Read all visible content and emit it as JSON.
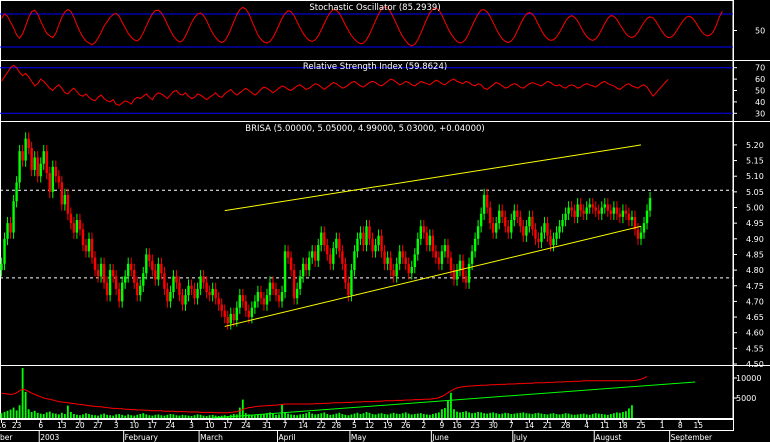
{
  "colors": {
    "background": "#000000",
    "frame": "#ffffff",
    "up_candle": "#00ff00",
    "down_candle": "#ff0000",
    "oscillator_line": "#ff0000",
    "band_line": "#0000ff",
    "channel_line": "#ffff00",
    "volume_bar": "#00ff00",
    "volume_average": "#ff0000",
    "volume_trend": "#00ff00"
  },
  "stochastic": {
    "title": "Stochastic Oscillator (85.2939)",
    "current": 85.2939,
    "ylim": [
      0,
      100
    ],
    "bands": [
      80,
      20
    ],
    "ticks": [
      "50"
    ],
    "values": [
      72,
      80,
      76,
      65,
      55,
      42,
      36,
      44,
      58,
      74,
      84,
      87,
      80,
      67,
      55,
      45,
      40,
      37,
      45,
      60,
      74,
      84,
      88,
      85,
      74,
      60,
      48,
      38,
      31,
      27,
      24,
      28,
      36,
      46,
      58,
      66,
      74,
      79,
      81,
      76,
      65,
      55,
      45,
      38,
      33,
      31,
      36,
      46,
      58,
      70,
      80,
      86,
      87,
      82,
      73,
      61,
      50,
      40,
      33,
      29,
      31,
      40,
      52,
      64,
      74,
      80,
      82,
      77,
      68,
      56,
      45,
      37,
      31,
      28,
      31,
      40,
      52,
      66,
      79,
      88,
      92,
      89,
      80,
      67,
      54,
      42,
      34,
      29,
      27,
      30,
      37,
      48,
      60,
      72,
      81,
      86,
      84,
      77,
      66,
      55,
      45,
      37,
      32,
      30,
      33,
      40,
      51,
      63,
      74,
      83,
      88,
      87,
      81,
      71,
      60,
      50,
      41,
      34,
      29,
      26,
      27,
      33,
      43,
      55,
      68,
      80,
      89,
      93,
      91,
      84,
      73,
      61,
      49,
      39,
      31,
      25,
      22,
      25,
      33,
      45,
      58,
      71,
      82,
      89,
      91,
      87,
      78,
      66,
      54,
      44,
      36,
      30,
      27,
      29,
      35,
      46,
      58,
      70,
      80,
      87,
      88,
      84,
      75,
      64,
      53,
      43,
      35,
      30,
      28,
      31,
      38,
      49,
      61,
      72,
      80,
      83,
      80,
      72,
      61,
      50,
      41,
      35,
      32,
      33,
      38,
      47,
      57,
      67,
      74,
      77,
      74,
      67,
      57,
      47,
      39,
      34,
      32,
      35,
      42,
      52,
      63,
      72,
      77,
      76,
      70,
      61,
      52,
      44,
      39,
      37,
      40,
      47,
      56,
      65,
      72,
      75,
      73,
      66,
      57,
      48,
      41,
      37,
      38,
      43,
      51,
      60,
      68,
      74,
      76,
      73,
      66,
      57,
      49,
      43,
      40,
      42,
      48,
      60,
      75,
      85
    ]
  },
  "rsi": {
    "title": "Relative Strength Index (59.8624)",
    "current": 59.8624,
    "ylim": [
      25,
      75
    ],
    "bands": [
      70,
      30
    ],
    "ticks": [
      "70",
      "60",
      "50",
      "40",
      "30"
    ],
    "values": [
      58,
      62,
      66,
      70,
      72,
      70,
      66,
      63,
      65,
      62,
      58,
      54,
      56,
      60,
      58,
      55,
      52,
      50,
      53,
      55,
      52,
      48,
      47,
      50,
      52,
      49,
      46,
      45,
      47,
      44,
      42,
      41,
      44,
      46,
      43,
      41,
      40,
      42,
      38,
      37,
      39,
      41,
      40,
      38,
      42,
      44,
      43,
      45,
      47,
      44,
      42,
      46,
      48,
      47,
      45,
      43,
      46,
      49,
      50,
      47,
      46,
      48,
      45,
      43,
      44,
      47,
      46,
      44,
      42,
      44,
      46,
      48,
      45,
      44,
      47,
      49,
      51,
      48,
      46,
      48,
      50,
      52,
      50,
      48,
      46,
      48,
      51,
      53,
      52,
      50,
      48,
      50,
      52,
      54,
      53,
      51,
      50,
      52,
      54,
      55,
      53,
      51,
      52,
      54,
      56,
      55,
      53,
      51,
      53,
      55,
      57,
      56,
      54,
      52,
      53,
      55,
      57,
      58,
      56,
      54,
      53,
      55,
      57,
      58,
      57,
      55,
      54,
      56,
      58,
      60,
      59,
      57,
      55,
      56,
      58,
      57,
      55,
      54,
      56,
      58,
      57,
      56,
      55,
      57,
      59,
      58,
      56,
      55,
      57,
      59,
      60,
      58,
      57,
      56,
      58,
      57,
      55,
      54,
      56,
      55,
      52,
      51,
      53,
      55,
      57,
      56,
      54,
      52,
      53,
      55,
      56,
      55,
      53,
      52,
      54,
      56,
      57,
      56,
      55,
      54,
      56,
      58,
      57,
      55,
      54,
      55,
      53,
      52,
      54,
      55,
      54,
      52,
      53,
      55,
      56,
      55,
      54,
      53,
      55,
      57,
      58,
      56,
      55,
      54,
      52,
      51,
      53,
      55,
      56,
      54,
      53,
      52,
      54,
      55,
      53,
      49,
      45,
      48,
      51,
      54,
      57,
      59.8624
    ]
  },
  "price": {
    "title": "BRISA (5.00000, 5.05000, 4.99000, 5.03000, +0.04000)",
    "ylim": [
      4.5,
      5.27
    ],
    "ticks": [
      "5.20",
      "5.15",
      "5.10",
      "5.05",
      "5.00",
      "4.95",
      "4.90",
      "4.85",
      "4.80",
      "4.75",
      "4.70",
      "4.65",
      "4.60",
      "4.55",
      "4.50"
    ],
    "reference_levels": [
      5.055,
      4.775
    ],
    "closes": [
      4.82,
      4.9,
      4.95,
      4.92,
      5.02,
      5.08,
      5.18,
      5.15,
      5.22,
      5.19,
      5.12,
      5.16,
      5.1,
      5.14,
      5.18,
      5.11,
      5.05,
      5.13,
      5.1,
      5.08,
      5.01,
      5.04,
      4.98,
      4.95,
      4.92,
      4.96,
      4.93,
      4.88,
      4.86,
      4.9,
      4.84,
      4.8,
      4.78,
      4.82,
      4.76,
      4.72,
      4.8,
      4.78,
      4.74,
      4.7,
      4.76,
      4.78,
      4.82,
      4.8,
      4.76,
      4.72,
      4.75,
      4.79,
      4.85,
      4.83,
      4.8,
      4.77,
      4.82,
      4.79,
      4.74,
      4.7,
      4.73,
      4.78,
      4.76,
      4.72,
      4.69,
      4.72,
      4.75,
      4.74,
      4.71,
      4.74,
      4.78,
      4.76,
      4.73,
      4.72,
      4.74,
      4.71,
      4.69,
      4.67,
      4.65,
      4.63,
      4.66,
      4.64,
      4.68,
      4.72,
      4.7,
      4.67,
      4.65,
      4.68,
      4.7,
      4.73,
      4.71,
      4.69,
      4.72,
      4.76,
      4.74,
      4.72,
      4.7,
      4.73,
      4.86,
      4.84,
      4.8,
      4.71,
      4.74,
      4.78,
      4.82,
      4.8,
      4.84,
      4.86,
      4.83,
      4.88,
      4.92,
      4.88,
      4.85,
      4.82,
      4.87,
      4.9,
      4.86,
      4.82,
      4.76,
      4.72,
      4.8,
      4.86,
      4.9,
      4.92,
      4.88,
      4.94,
      4.9,
      4.86,
      4.88,
      4.91,
      4.86,
      4.82,
      4.84,
      4.8,
      4.78,
      4.82,
      4.86,
      4.84,
      4.82,
      4.79,
      4.81,
      4.85,
      4.9,
      4.94,
      4.92,
      4.88,
      4.91,
      4.86,
      4.84,
      4.82,
      4.86,
      4.88,
      4.84,
      4.8,
      4.77,
      4.8,
      4.83,
      4.78,
      4.76,
      4.82,
      4.86,
      4.9,
      4.94,
      4.98,
      5.04,
      5.0,
      4.95,
      4.92,
      4.95,
      4.99,
      4.97,
      4.94,
      4.92,
      4.96,
      4.99,
      4.97,
      4.94,
      4.91,
      4.94,
      4.97,
      4.93,
      4.9,
      4.89,
      4.92,
      4.95,
      4.91,
      4.88,
      4.9,
      4.92,
      4.94,
      4.96,
      4.98,
      5.0,
      4.99,
      4.97,
      5.01,
      4.99,
      4.98,
      5.0,
      5.01,
      5.0,
      4.99,
      4.98,
      5.0,
      5.01,
      4.99,
      4.98,
      5.0,
      4.98,
      4.97,
      4.99,
      4.98,
      4.96,
      4.97,
      4.93,
      4.9,
      4.92,
      4.95,
      4.99,
      5.03
    ]
  },
  "channel": {
    "upper": {
      "from": {
        "index": 74,
        "price": 4.99
      },
      "to": {
        "index": 212,
        "price": 5.2
      }
    },
    "lower": {
      "from": {
        "index": 74,
        "price": 4.62
      },
      "to": {
        "index": 212,
        "price": 4.94
      }
    }
  },
  "volume": {
    "ylim": [
      0,
      13000
    ],
    "ticks": [
      "10000",
      "5000"
    ],
    "bars": [
      1200,
      1500,
      1800,
      2100,
      2600,
      1900,
      3200,
      12500,
      6500,
      2200,
      1500,
      1800,
      1300,
      1100,
      1000,
      1400,
      1600,
      1200,
      1100,
      900,
      1300,
      1000,
      3100,
      1500,
      1000,
      800,
      700,
      900,
      1200,
      1000,
      800,
      700,
      600,
      900,
      1100,
      800,
      700,
      600,
      900,
      1000,
      800,
      600,
      900,
      700,
      600,
      800,
      1000,
      1200,
      900,
      700,
      600,
      800,
      900,
      700,
      600,
      800,
      1000,
      900,
      700,
      600,
      800,
      700,
      600,
      500,
      700,
      900,
      800,
      600,
      500,
      700,
      800,
      600,
      500,
      600,
      700,
      500,
      800,
      1000,
      900,
      2600,
      4600,
      1200,
      900,
      800,
      700,
      900,
      800,
      1000,
      1200,
      1400,
      1000,
      800,
      900,
      3300,
      1500,
      1100,
      900,
      800,
      700,
      900,
      1000,
      1200,
      1500,
      1100,
      900,
      1000,
      1200,
      1400,
      1000,
      800,
      900,
      1100,
      1300,
      1000,
      800,
      700,
      900,
      1100,
      1300,
      1000,
      1200,
      1500,
      1300,
      1000,
      900,
      1100,
      1200,
      1000,
      900,
      1100,
      1300,
      1100,
      1000,
      1200,
      1400,
      1100,
      900,
      1000,
      1100,
      1200,
      1000,
      900,
      800,
      1000,
      1200,
      1400,
      2200,
      2500,
      4500,
      6300,
      2200,
      1600,
      1400,
      1500,
      1700,
      1400,
      1200,
      1300,
      1500,
      1400,
      1200,
      1100,
      1300,
      1400,
      1200,
      1000,
      1100,
      1300,
      1200,
      1000,
      1100,
      1200,
      1300,
      1400,
      1200,
      1100,
      1000,
      1200,
      1300,
      1100,
      1000,
      900,
      1100,
      1200,
      1000,
      900,
      1000,
      1200,
      1100,
      900,
      800,
      900,
      1000,
      1100,
      900,
      800,
      1000,
      1200,
      1100,
      1000,
      900,
      800,
      1000,
      1200,
      1400,
      1300,
      1500,
      1700,
      2400,
      3200
    ],
    "average": [
      6200,
      6100,
      6000,
      5900,
      6000,
      6300,
      6800,
      7200,
      7000,
      6600,
      6200,
      5900,
      5600,
      5300,
      5000,
      4800,
      4700,
      4500,
      4300,
      4100,
      4000,
      3900,
      3800,
      3700,
      3600,
      3500,
      3400,
      3300,
      3200,
      3100,
      3000,
      2900,
      2800,
      2800,
      2700,
      2600,
      2500,
      2400,
      2400,
      2300,
      2300,
      2200,
      2200,
      2100,
      2100,
      2000,
      2000,
      2000,
      1900,
      1900,
      1800,
      1800,
      1800,
      1800,
      1700,
      1700,
      1700,
      1700,
      1600,
      1600,
      1600,
      1600,
      1500,
      1500,
      1500,
      1500,
      1400,
      1400,
      1400,
      1400,
      1400,
      1300,
      1300,
      1300,
      1300,
      1300,
      1400,
      1500,
      1600,
      1800,
      2100,
      2400,
      2600,
      2700,
      2800,
      2900,
      3000,
      3000,
      3100,
      3100,
      3200,
      3200,
      3300,
      3400,
      3500,
      3500,
      3500,
      3500,
      3500,
      3500,
      3500,
      3500,
      3500,
      3500,
      3600,
      3600,
      3600,
      3700,
      3700,
      3700,
      3800,
      3800,
      3800,
      3800,
      3900,
      3900,
      3900,
      4000,
      4000,
      4000,
      4100,
      4100,
      4100,
      4100,
      4200,
      4200,
      4200,
      4300,
      4300,
      4300,
      4300,
      4400,
      4400,
      4400,
      4500,
      4500,
      4500,
      4600,
      4600,
      4600,
      4700,
      4700,
      4700,
      4800,
      4900,
      5100,
      5400,
      5800,
      6300,
      6800,
      7200,
      7500,
      7700,
      7800,
      7900,
      8000,
      8000,
      8100,
      8100,
      8200,
      8200,
      8200,
      8300,
      8300,
      8300,
      8400,
      8400,
      8400,
      8500,
      8500,
      8500,
      8600,
      8600,
      8600,
      8700,
      8700,
      8700,
      8800,
      8800,
      8800,
      8800,
      8900,
      8900,
      8900,
      9000,
      9000,
      9000,
      9100,
      9100,
      9100,
      9200,
      9200,
      9200,
      9300,
      9300,
      9300,
      9300,
      9300,
      9300,
      9300,
      9300,
      9300,
      9300,
      9300,
      9300,
      9300,
      9300,
      9300,
      9300,
      9300,
      9400,
      9500,
      9700,
      10000,
      10400
    ],
    "trend": {
      "from": {
        "index": 70,
        "value": 0
      },
      "to": {
        "index": 230,
        "value": 9000
      }
    }
  },
  "x_axis": {
    "slots": 243,
    "day_labels": [
      {
        "i": 0,
        "t": "16"
      },
      {
        "i": 5,
        "t": "23"
      },
      {
        "i": 13,
        "t": "6"
      },
      {
        "i": 20,
        "t": "13"
      },
      {
        "i": 26,
        "t": "20"
      },
      {
        "i": 32,
        "t": "27"
      },
      {
        "i": 38,
        "t": "3"
      },
      {
        "i": 44,
        "t": "10"
      },
      {
        "i": 50,
        "t": "17"
      },
      {
        "i": 56,
        "t": "24"
      },
      {
        "i": 63,
        "t": "3"
      },
      {
        "i": 69,
        "t": "10"
      },
      {
        "i": 75,
        "t": "17"
      },
      {
        "i": 81,
        "t": "24"
      },
      {
        "i": 88,
        "t": "31"
      },
      {
        "i": 94,
        "t": "7"
      },
      {
        "i": 100,
        "t": "14"
      },
      {
        "i": 106,
        "t": "22"
      },
      {
        "i": 111,
        "t": "28"
      },
      {
        "i": 117,
        "t": "5"
      },
      {
        "i": 122,
        "t": "12"
      },
      {
        "i": 128,
        "t": "19"
      },
      {
        "i": 134,
        "t": "26"
      },
      {
        "i": 140,
        "t": "2"
      },
      {
        "i": 146,
        "t": "9"
      },
      {
        "i": 151,
        "t": "16"
      },
      {
        "i": 157,
        "t": "23"
      },
      {
        "i": 163,
        "t": "30"
      },
      {
        "i": 169,
        "t": "7"
      },
      {
        "i": 175,
        "t": "14"
      },
      {
        "i": 181,
        "t": "21"
      },
      {
        "i": 187,
        "t": "28"
      },
      {
        "i": 194,
        "t": "4"
      },
      {
        "i": 200,
        "t": "11"
      },
      {
        "i": 206,
        "t": "18"
      },
      {
        "i": 212,
        "t": "25"
      },
      {
        "i": 219,
        "t": "1"
      },
      {
        "i": 225,
        "t": "8"
      },
      {
        "i": 231,
        "t": "15"
      }
    ],
    "month_labels": [
      {
        "i": -3,
        "t": "ber"
      },
      {
        "i": 13,
        "t": "2003"
      },
      {
        "i": 41,
        "t": "February"
      },
      {
        "i": 66,
        "t": "March"
      },
      {
        "i": 92,
        "t": "April"
      },
      {
        "i": 116,
        "t": "May"
      },
      {
        "i": 143,
        "t": "June"
      },
      {
        "i": 170,
        "t": "July"
      },
      {
        "i": 197,
        "t": "August"
      },
      {
        "i": 222,
        "t": "September"
      }
    ]
  }
}
